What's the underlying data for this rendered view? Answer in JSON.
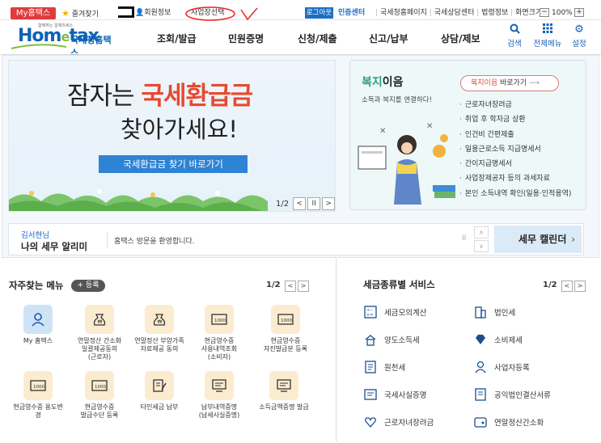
{
  "topbar": {
    "my_home": "My홈택스",
    "favorites": "즐겨찾기",
    "member_info": "회원정보",
    "business_select": "사업장선택",
    "login": "로그아웃",
    "auth_center": "인증센터",
    "links": [
      "국세청홈페이지",
      "국세상담센터",
      "법령정보",
      "화면크기"
    ],
    "zoom": "100%"
  },
  "header": {
    "logo_small": "함께하는 일체의세스",
    "logo_text_main": "Hom",
    "logo_text_e": "e",
    "logo_text_end": "tax",
    "logo_sub": "국세청홈택스",
    "nav": [
      "조회/발급",
      "민원증명",
      "신청/제출",
      "신고/납부",
      "상담/제보"
    ],
    "icons": [
      {
        "name": "search-icon",
        "label": "검색"
      },
      {
        "name": "grid-menu-icon",
        "label": "전체메뉴"
      },
      {
        "name": "gear-icon",
        "label": "설정"
      }
    ]
  },
  "banner": {
    "line1_pre": "잠자는 ",
    "line1_highlight": "국세환급금",
    "line2": "찾아가세요!",
    "button": "국세환급금 찾기 바로가기",
    "page": "1/2"
  },
  "welfare": {
    "title_green": "복지",
    "title_rest": "이음",
    "subtitle": "소득과 복지를 연결하다!",
    "link_red": "복지이음",
    "link_rest": " 바로가기",
    "items": [
      "근로자녀장려금",
      "취업 후 학자금 상환",
      "인건비 간편제출",
      "일용근로소득 지급명세서",
      "간이지급명세서",
      "사업장제공자 등의 과세자료",
      "본인 소득내역 확인(일용·인적용역)"
    ]
  },
  "notice": {
    "user": "김서현님",
    "title": "나의 세무 알리미",
    "message": "홈택스 방문을 환영합니다.",
    "calendar": "세무 캘린더"
  },
  "frequent": {
    "title": "자주찾는 메뉴",
    "register": "등록",
    "page": "1/2",
    "items": [
      "My 홈택스",
      "연말정산 간소화\n일괄제공동의\n(근로자)",
      "연말정산 부양가족\n자료제공 동의",
      "현금영수증\n사용내역조회\n(소비자)",
      "현금영수증\n자진발급분 등록",
      "현금영수증 용도변\n경",
      "현금영수증\n발급수단 등록",
      "타인세금 납부",
      "납부내역증명\n(납세사실증명)",
      "소득금액증명 발급"
    ]
  },
  "tax_service": {
    "title": "세금종류별 서비스",
    "page": "1/2",
    "left": [
      "세금모의계산",
      "양도소득세",
      "원천세",
      "국세사실증명",
      "근로자녀장려금"
    ],
    "right": [
      "법인세",
      "소비제세",
      "사업자등록",
      "공익법인결산서류",
      "연말정산간소화"
    ]
  },
  "colors": {
    "brand_blue": "#0b63b5",
    "accent_red": "#e8492f",
    "welfare_green": "#2fa079"
  }
}
